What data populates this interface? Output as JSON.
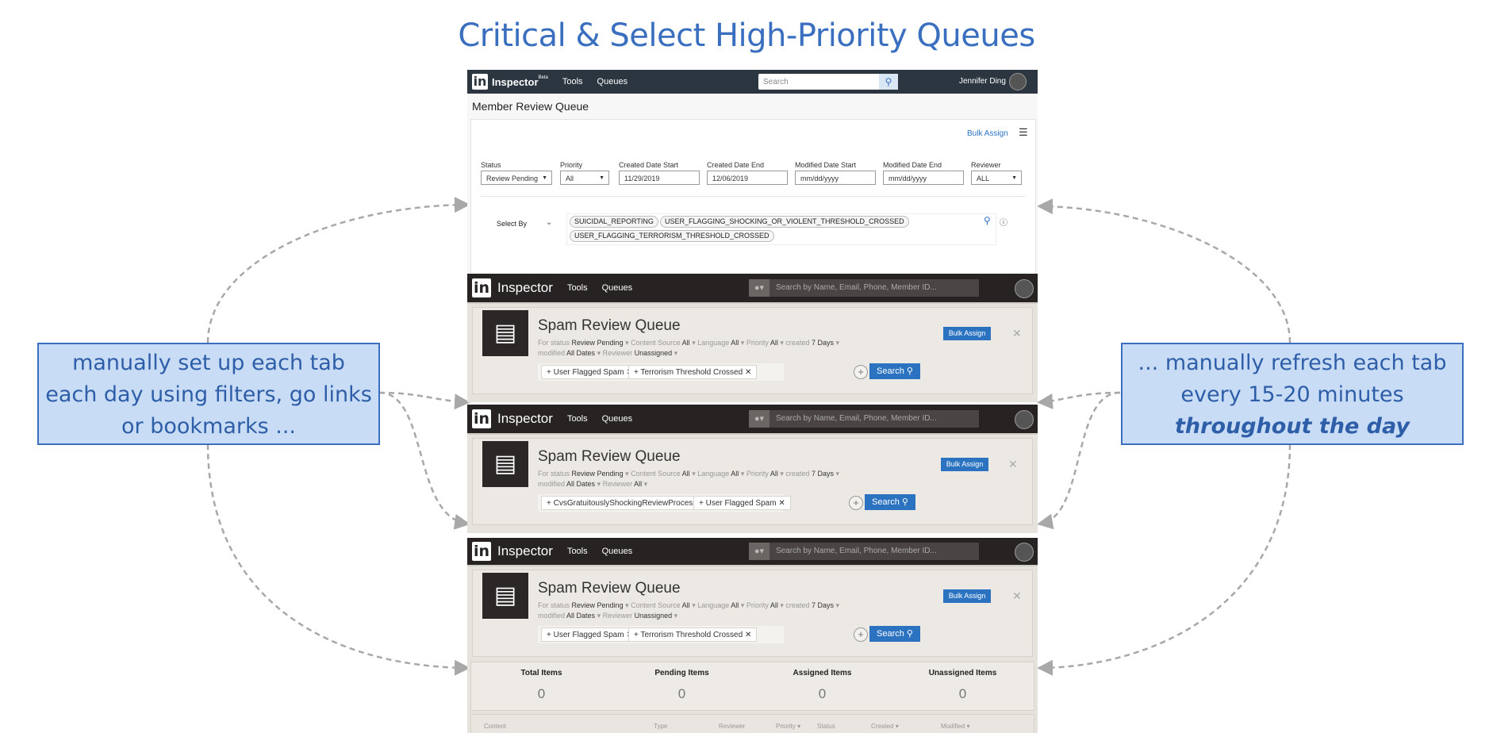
{
  "slide_title": "Critical & Select High-Priority Queues",
  "callout_left": "manually set up each tab each day using filters, go links or bookmarks ...",
  "callout_right_prefix": "... manually refresh each tab every 15-20 minutes ",
  "callout_right_emphasis": "throughout the day",
  "colors": {
    "accent": "#3a6fc0",
    "callout_bg": "#c8dcf5",
    "button": "#2b73c1"
  },
  "old_ui": {
    "logo": "in",
    "brand": "Inspector",
    "beta": "Beta",
    "nav": [
      "Tools",
      "Queues"
    ],
    "search_placeholder": "Search",
    "user": "Jennifer Ding",
    "page_title": "Member Review Queue",
    "bulk_assign": "Bulk Assign",
    "filters": [
      {
        "label": "Status",
        "value": "Review Pending"
      },
      {
        "label": "Priority",
        "value": "All"
      },
      {
        "label": "Created Date Start",
        "value": "11/29/2019"
      },
      {
        "label": "Created Date End",
        "value": "12/06/2019"
      },
      {
        "label": "Modified Date Start",
        "value": "mm/dd/yyyy"
      },
      {
        "label": "Modified Date End",
        "value": "mm/dd/yyyy"
      },
      {
        "label": "Reviewer",
        "value": "ALL"
      }
    ],
    "select_by": "Select By",
    "chips": [
      "SUICIDAL_REPORTING",
      "USER_FLAGGING_SHOCKING_OR_VIOLENT_THRESHOLD_CROSSED",
      "USER_FLAGGING_TERRORISM_THRESHOLD_CROSSED"
    ]
  },
  "new_ui": {
    "logo": "in",
    "brand": "Inspector",
    "nav": [
      "Tools",
      "Queues"
    ],
    "search_placeholder": "Search by Name, Email, Phone, Member ID...",
    "queue_title": "Spam Review Queue",
    "bulk_assign": "Bulk Assign",
    "search_btn": "Search",
    "meta_labels": {
      "for_status": "For status",
      "content_source": "Content Source",
      "language": "Language",
      "priority": "Priority",
      "created": "created",
      "modified": "modified",
      "reviewer": "Reviewer"
    },
    "panels": [
      {
        "status": "Review Pending",
        "content_source": "All",
        "language": "All",
        "priority": "All",
        "created": "7 Days",
        "modified": "All Dates",
        "reviewer": "Unassigned",
        "tags": [
          "User Flagged Spam",
          "Terrorism Threshold Crossed"
        ]
      },
      {
        "status": "Review Pending",
        "content_source": "All",
        "language": "All",
        "priority": "All",
        "created": "7 Days",
        "modified": "All Dates",
        "reviewer": "All",
        "tags": [
          "CvsGratuitouslyShockingReviewProcessor",
          "User Flagged Spam"
        ]
      },
      {
        "status": "Review Pending",
        "content_source": "All",
        "language": "All",
        "priority": "All",
        "created": "7 Days",
        "modified": "All Dates",
        "reviewer": "Unassigned",
        "tags": [
          "User Flagged Spam",
          "Terrorism Threshold Crossed"
        ]
      }
    ],
    "stats": [
      {
        "label": "Total Items",
        "value": "0"
      },
      {
        "label": "Pending Items",
        "value": "0"
      },
      {
        "label": "Assigned Items",
        "value": "0"
      },
      {
        "label": "Unassigned Items",
        "value": "0"
      }
    ],
    "table_headers": [
      "Content",
      "Type",
      "Reviewer",
      "Priority",
      "Status",
      "Created",
      "Modified"
    ]
  }
}
